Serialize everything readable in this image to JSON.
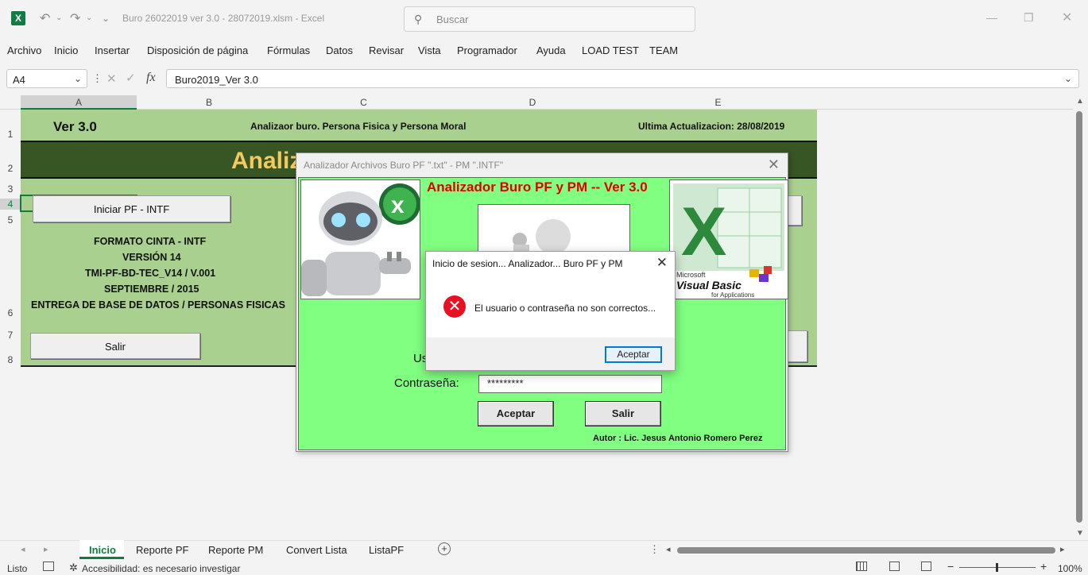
{
  "window": {
    "title": "Buro 26022019 ver 3.0 - 28072019.xlsm  -  Excel",
    "search_placeholder": "Buscar"
  },
  "menu": [
    "Archivo",
    "Inicio",
    "Insertar",
    "Disposición de página",
    "Fórmulas",
    "Datos",
    "Revisar",
    "Vista",
    "Programador",
    "Ayuda",
    "LOAD TEST",
    "TEAM"
  ],
  "formula_bar": {
    "name_box": "A4",
    "fx": "fx",
    "content": "Buro2019_Ver 3.0"
  },
  "columns": [
    "A",
    "B",
    "C",
    "D",
    "E"
  ],
  "rows": [
    "1",
    "2",
    "3",
    "4",
    "5",
    "6",
    "7",
    "8"
  ],
  "sheet": {
    "version": "Ver 3.0",
    "subtitle": "Analizaor buro. Persona Fisica y Persona Moral",
    "last_update": "Ultima Actualizacion: 28/08/2019",
    "banner": "Analiz",
    "start_button": "Iniciar PF - INTF",
    "info_lines": [
      "FORMATO CINTA - INTF",
      "VERSIÓN 14",
      "TMI-PF-BD-TEC_V14 / V.001",
      "SEPTIEMBRE / 2015",
      "ENTREGA DE BASE DE DATOS / PERSONAS FISICAS"
    ],
    "exit_button": "Salir"
  },
  "form": {
    "title": "Analizador Archivos Buro PF \".txt\" - PM \".INTF\"",
    "heading": "Analizador Buro PF y PM  -- Ver 3.0",
    "user_label": "Us",
    "password_label": "Contraseña:",
    "password_value": "*********",
    "accept_button": "Aceptar",
    "exit_button": "Salir",
    "author": "Autor : Lic. Jesus Antonio Romero Perez",
    "vba_text": "Visual Basic",
    "vba_sub": "for Applications",
    "ms_text": "Microsoft"
  },
  "message": {
    "title": "Inicio de sesion... Analizador... Buro PF y PM",
    "text": "El usuario o contraseña no son correctos...",
    "ok": "Aceptar"
  },
  "tabs": [
    "Inicio",
    "Reporte PF",
    "Reporte PM",
    "Convert Lista",
    "ListaPF"
  ],
  "status": {
    "ready": "Listo",
    "accessibility": "Accesibilidad: es necesario investigar",
    "zoom": "100%"
  },
  "colors": {
    "sheet_green": "#a9d08e",
    "band_dark": "#375623",
    "banner_gold": "#f4c95d",
    "form_green": "#80ff80",
    "heading_red": "#e00000",
    "excel_green": "#107c41"
  }
}
